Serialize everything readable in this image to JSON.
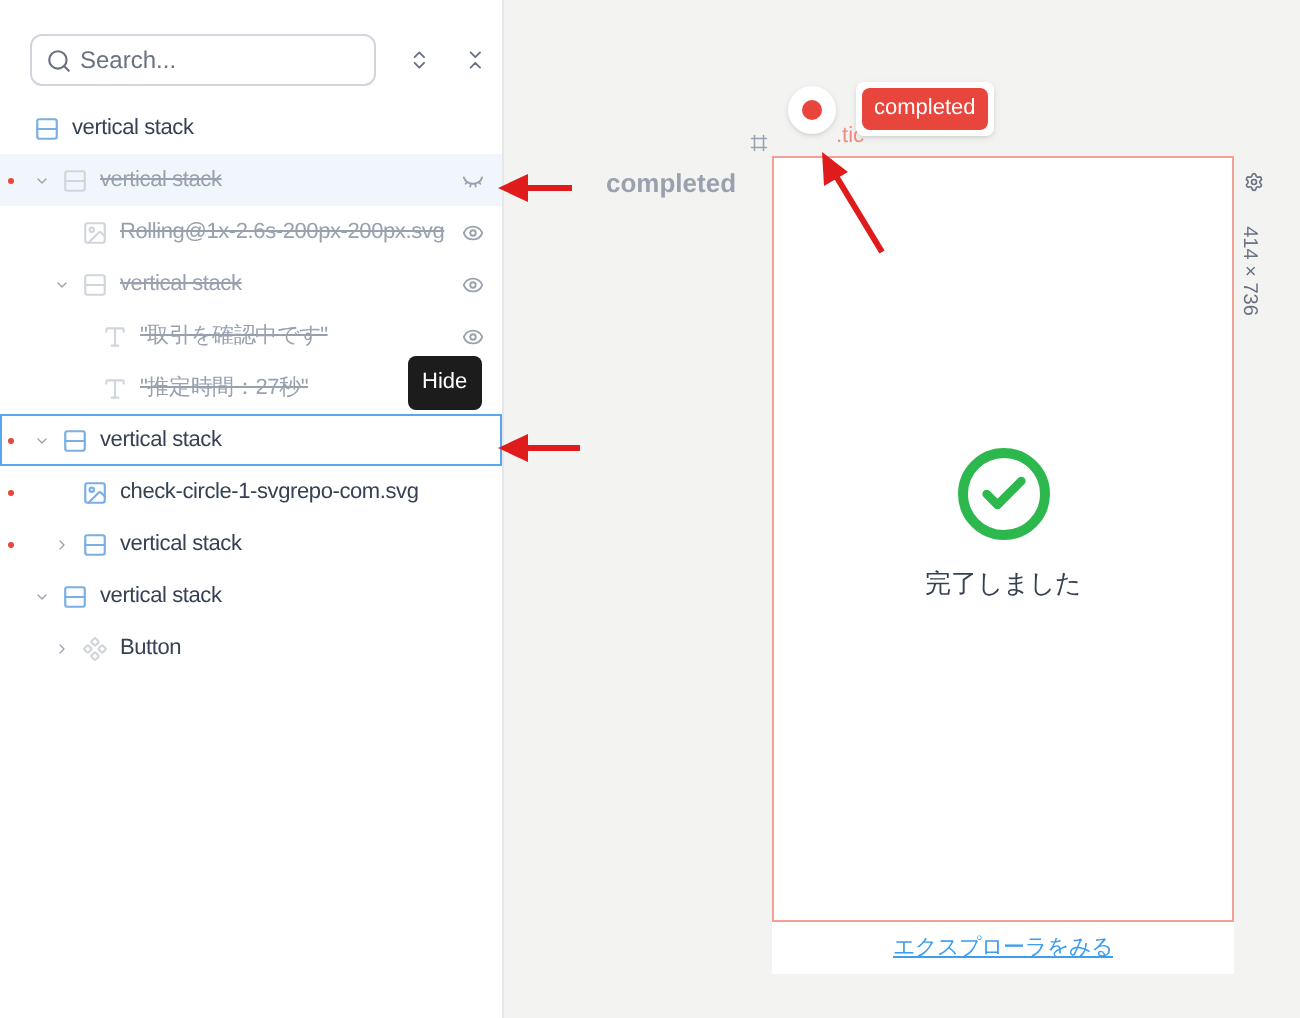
{
  "search": {
    "placeholder": "Search..."
  },
  "tree": {
    "label": "vertical stack",
    "kind": "stack",
    "hidden": false,
    "marked": false,
    "selected": false,
    "hovered": false,
    "children": [
      {
        "label": "vertical stack",
        "kind": "stack",
        "hidden": true,
        "marked": true,
        "selected": false,
        "hovered": true,
        "expanded": true,
        "eye_closed": true,
        "children": [
          {
            "label": "Rolling@1x-2.6s-200px-200px.svg",
            "kind": "image",
            "hidden": true,
            "marked": false,
            "selected": false,
            "hovered": false,
            "eye_closed": false
          },
          {
            "label": "vertical stack",
            "kind": "stack",
            "hidden": true,
            "marked": false,
            "selected": false,
            "hovered": false,
            "expanded": true,
            "eye_closed": false,
            "children": [
              {
                "label": "\"取引を確認中です\"",
                "kind": "text",
                "hidden": true,
                "marked": false,
                "selected": false,
                "hovered": false,
                "eye_closed": false
              },
              {
                "label": "\"推定時間：27秒\"",
                "kind": "text",
                "hidden": true,
                "marked": false,
                "selected": false,
                "hovered": false
              }
            ]
          }
        ]
      },
      {
        "label": "vertical stack",
        "kind": "stack",
        "hidden": false,
        "marked": true,
        "selected": true,
        "hovered": false,
        "expanded": true,
        "children": [
          {
            "label": "check-circle-1-svgrepo-com.svg",
            "kind": "image",
            "hidden": false,
            "marked": true,
            "selected": false,
            "hovered": false
          },
          {
            "label": "vertical stack",
            "kind": "stack",
            "hidden": false,
            "marked": true,
            "selected": false,
            "hovered": false,
            "expanded": false
          }
        ]
      },
      {
        "label": "vertical stack",
        "kind": "stack",
        "hidden": false,
        "marked": false,
        "selected": false,
        "hovered": false,
        "expanded": true,
        "children": [
          {
            "label": "Button",
            "kind": "component",
            "hidden": false,
            "marked": false,
            "selected": false,
            "hovered": false,
            "expanded": false
          }
        ]
      }
    ]
  },
  "tooltip": "Hide",
  "canvas": {
    "state_label": "completed",
    "frame_label": ".tic",
    "badge": "completed",
    "size": "414 × 736",
    "message": "完了しました",
    "link": "エクスプローラをみる"
  }
}
